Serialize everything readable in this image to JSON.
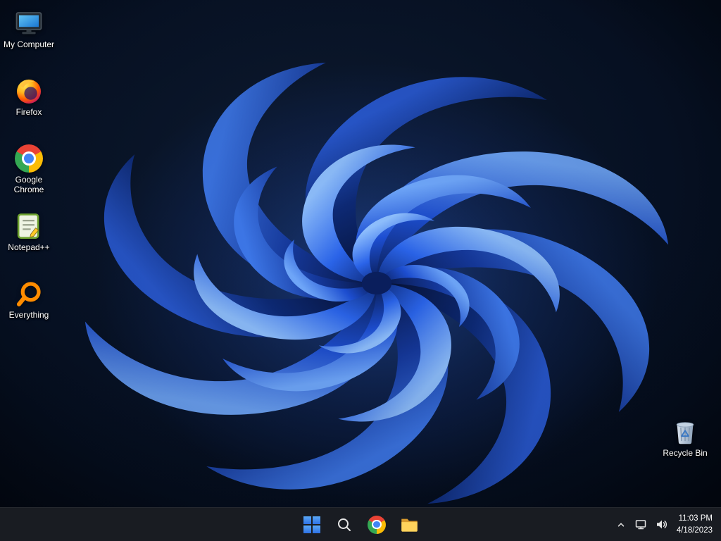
{
  "desktop": {
    "icons": [
      {
        "label": "My Computer"
      },
      {
        "label": "Firefox"
      },
      {
        "label": "Google Chrome"
      },
      {
        "label": "Notepad++"
      },
      {
        "label": "Everything"
      }
    ],
    "recycle_bin": {
      "label": "Recycle Bin"
    }
  },
  "taskbar": {
    "icons": [
      "start",
      "search",
      "chrome",
      "file-explorer"
    ],
    "tray": {
      "time": "11:03 PM",
      "date": "4/18/2023"
    }
  },
  "colors": {
    "taskbar_bg": "#191c22",
    "start_blue": "#4695f2",
    "wallpaper_base": "#04080f",
    "bloom_primary": "#2563eb",
    "bloom_highlight": "#71aaff"
  }
}
